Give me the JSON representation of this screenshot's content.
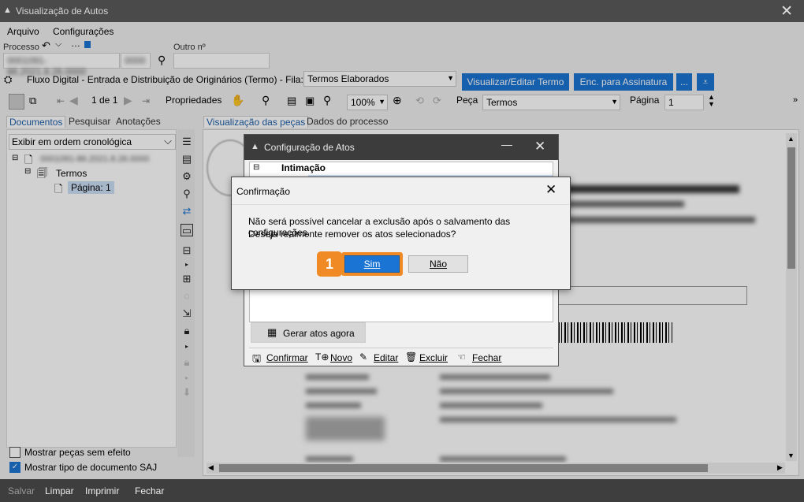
{
  "window": {
    "title": "Visualização de Autos",
    "icon": "app-icon"
  },
  "menu": {
    "arquivo": "Arquivo",
    "configuracoes": "Configurações"
  },
  "process": {
    "label": "Processo",
    "outro_label": "Outro nº",
    "number_part1": "0001091-86.2021.8.26.0000",
    "number_part2": "0000"
  },
  "flow": {
    "text": "Fluxo Digital - Entrada e Distribuição de Originários (Termo) - Fila:",
    "fila_value": "Termos Elaborados",
    "btn_visualizar": "Visualizar/Editar Termo",
    "btn_enc": "Enc. para Assinatura",
    "btn_more": "..."
  },
  "toolbar": {
    "page_indicator": "1 de 1",
    "propriedades": "Propriedades",
    "zoom": "100%",
    "peca_label": "Peça",
    "peca_value": "Termos",
    "pagina_label": "Página",
    "pagina_value": "1"
  },
  "tabs_left": [
    "Documentos",
    "Pesquisar",
    "Anotações"
  ],
  "tabs_right": [
    "Visualização das peças",
    "Dados do processo"
  ],
  "tree": {
    "order_select": "Exibir em ordem cronológica",
    "root": "0001091-86.2021.8.26.0000",
    "termos": "Termos",
    "pagina": "Página: 1"
  },
  "checkboxes": {
    "mostrar_sem_efeito": "Mostrar peças sem efeito",
    "mostrar_tipo": "Mostrar tipo de documento SAJ",
    "mostrar_sem_efeito_checked": false,
    "mostrar_tipo_checked": true
  },
  "statusbar": {
    "salvar": "Salvar",
    "limpar": "Limpar",
    "imprimir": "Imprimir",
    "fechar": "Fechar"
  },
  "cfg": {
    "title": "Configuração de Atos",
    "group": "Intimação",
    "gerar": "Gerar atos agora",
    "confirmar": "Confirmar",
    "novo": "Novo",
    "editar": "Editar",
    "excluir": "Excluir",
    "fechar": "Fechar"
  },
  "dialog": {
    "title": "Confirmação",
    "message_line1": "Não será possível cancelar a exclusão após o salvamento das configurações.",
    "message_line2": "Deseja realmente remover os atos selecionados?",
    "sim": "Sim",
    "nao": "Não",
    "step_badge": "1"
  },
  "colors": {
    "accent": "#1a74d4",
    "badge": "#f08a24",
    "titlebar": "#4a4a4a"
  }
}
